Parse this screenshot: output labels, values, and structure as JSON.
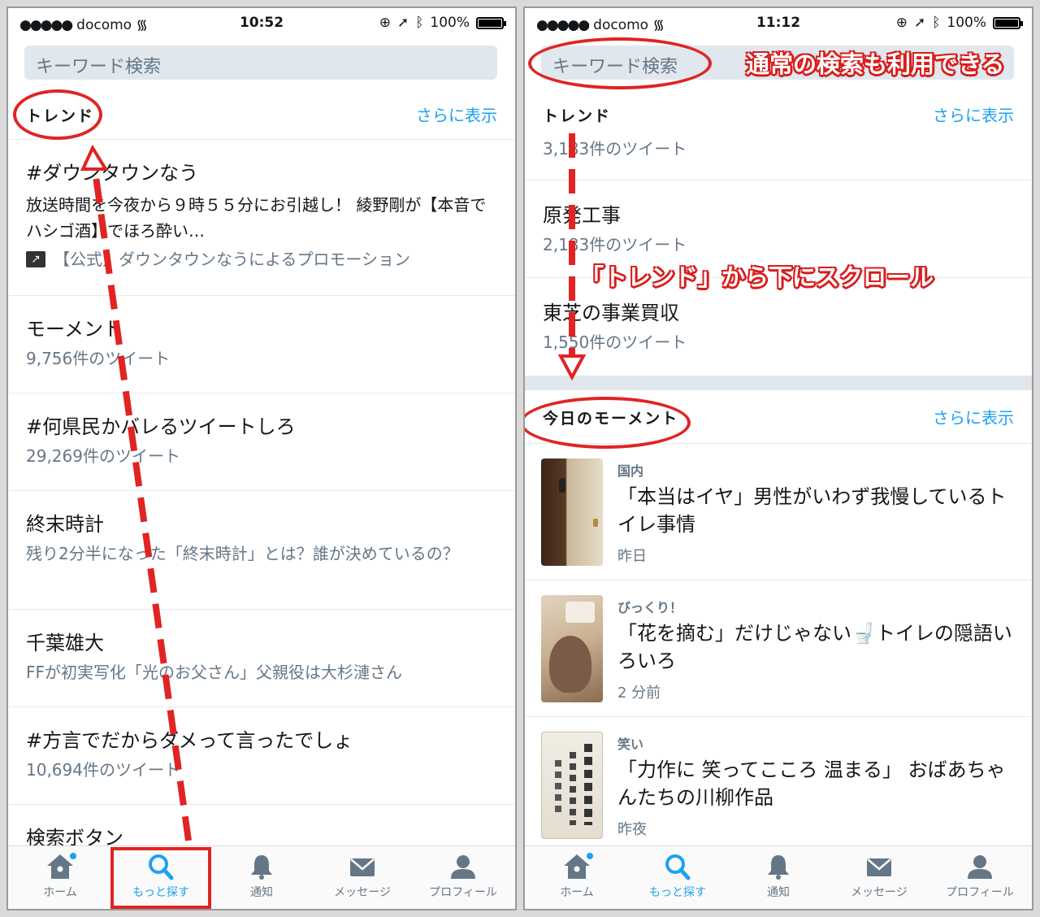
{
  "left": {
    "status": {
      "carrier": "docomo",
      "time": "10:52",
      "battery": "100%"
    },
    "search_placeholder": "キーワード検索",
    "section": {
      "label": "トレンド",
      "more": "さらに表示"
    },
    "trends": [
      {
        "name": "#ダウンタウンなう",
        "desc": "放送時間を今夜から９時５５分にお引越し！ 綾野剛が【本音でハシゴ酒】でほろ酔い…",
        "promo": "【公式】ダウンタウンなうによるプロモーション"
      },
      {
        "name": "モーメント",
        "meta": "9,756件のツイート"
      },
      {
        "name": "#何県民かバレるツイートしろ",
        "meta": "29,269件のツイート"
      },
      {
        "name": "終末時計",
        "meta": "残り2分半になった「終末時計」とは？誰が決めているの？"
      },
      {
        "name": "千葉雄大",
        "meta": "FFが初実写化「光のお父さん」父親役は大杉漣さん"
      },
      {
        "name": "#方言でだからダメって言ったでしょ",
        "meta": "10,694件のツイート"
      },
      {
        "name": "検索ボタン"
      }
    ]
  },
  "right": {
    "status": {
      "carrier": "docomo",
      "time": "11:12",
      "battery": "100%"
    },
    "search_placeholder": "キーワード検索",
    "trend_section": {
      "label": "トレンド",
      "more": "さらに表示"
    },
    "trends": [
      {
        "meta": "3,183件のツイート"
      },
      {
        "name": "原発工事",
        "meta": "2,183件のツイート"
      },
      {
        "name": "東芝の事業買収",
        "meta": "1,550件のツイート"
      }
    ],
    "moment_section": {
      "label": "今日のモーメント",
      "more": "さらに表示"
    },
    "moments": [
      {
        "category": "国内",
        "title": "「本当はイヤ」男性がいわず我慢しているトイレ事情",
        "time": "昨日"
      },
      {
        "category": "びっくり！",
        "title": "「花を摘む」だけじゃない🚽トイレの隠語いろいろ",
        "time": "2 分前"
      },
      {
        "category": "笑い",
        "title": "「力作に 笑ってこころ 温まる」 おばあちゃんたちの川柳作品",
        "time": "昨夜"
      }
    ]
  },
  "tabs": [
    {
      "label": "ホーム",
      "icon": "home-icon"
    },
    {
      "label": "もっと探す",
      "icon": "search-icon"
    },
    {
      "label": "通知",
      "icon": "bell-icon"
    },
    {
      "label": "メッセージ",
      "icon": "envelope-icon"
    },
    {
      "label": "プロフィール",
      "icon": "person-icon"
    }
  ],
  "annotations": {
    "normal_search": "通常の検索も利用できる",
    "scroll_down": "「トレンド」から下にスクロール"
  },
  "colors": {
    "accent": "#1da1f2",
    "annotation_red": "#e02424",
    "secondary_text": "#657786"
  }
}
